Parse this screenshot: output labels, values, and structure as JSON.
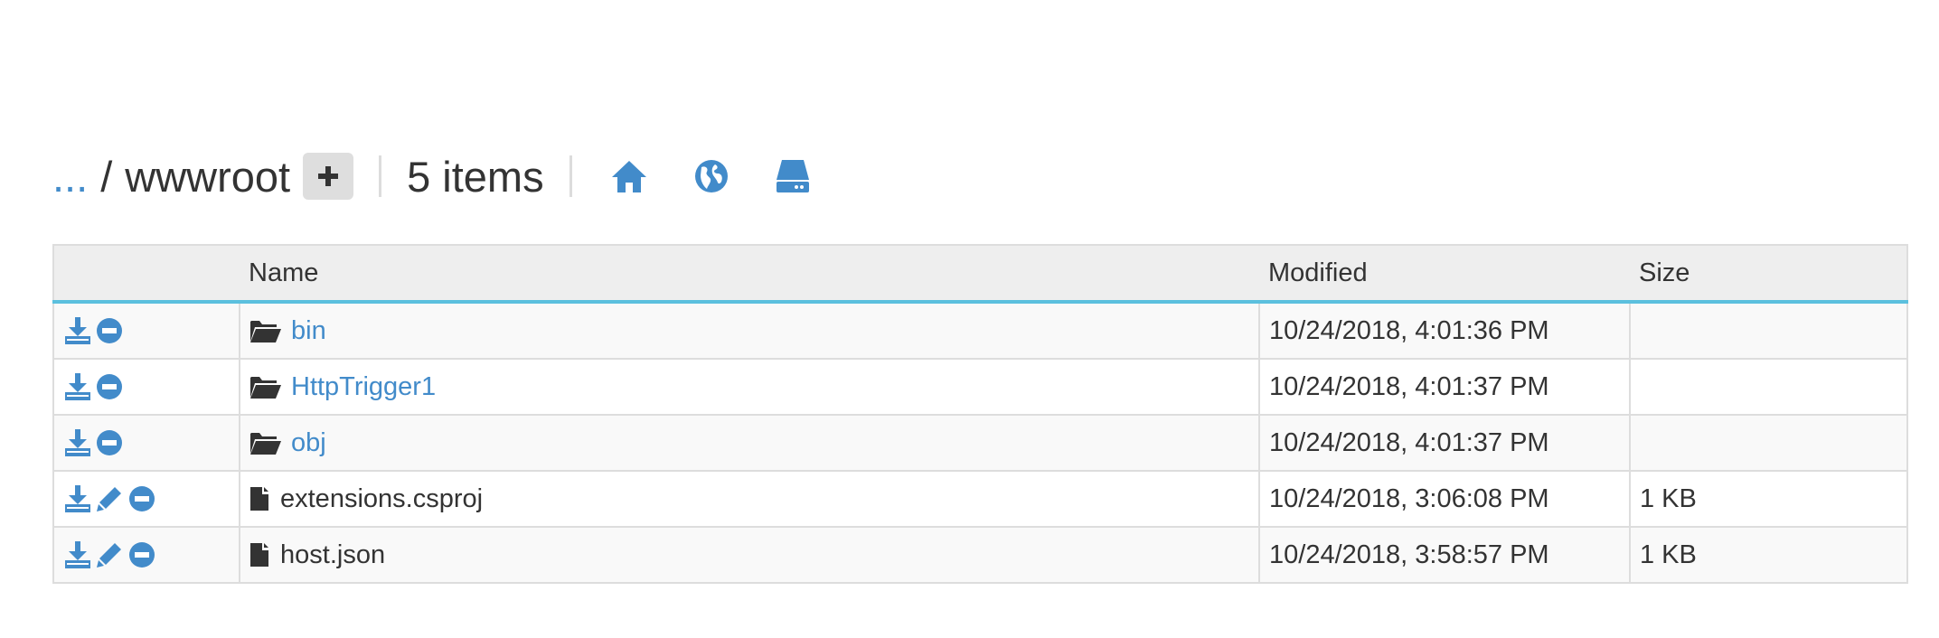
{
  "breadcrumb": {
    "ellipsis": "...",
    "separator": "/",
    "current": "wwwroot"
  },
  "item_count": "5 items",
  "toolbar": {
    "add_icon": "plus-icon",
    "home_icon": "home-icon",
    "globe_icon": "globe-icon",
    "drive_icon": "drive-icon"
  },
  "table": {
    "columns": [
      "",
      "Name",
      "Modified",
      "Size"
    ],
    "rows": [
      {
        "type": "folder",
        "name": "bin",
        "modified": "10/24/2018, 4:01:36 PM",
        "size": ""
      },
      {
        "type": "folder",
        "name": "HttpTrigger1",
        "modified": "10/24/2018, 4:01:37 PM",
        "size": ""
      },
      {
        "type": "folder",
        "name": "obj",
        "modified": "10/24/2018, 4:01:37 PM",
        "size": ""
      },
      {
        "type": "file",
        "name": "extensions.csproj",
        "modified": "10/24/2018, 3:06:08 PM",
        "size": "1 KB"
      },
      {
        "type": "file",
        "name": "host.json",
        "modified": "10/24/2018, 3:58:57 PM",
        "size": "1 KB"
      }
    ]
  },
  "colors": {
    "accent": "#428bca",
    "header_rule": "#5bc0de",
    "text": "#333333"
  }
}
